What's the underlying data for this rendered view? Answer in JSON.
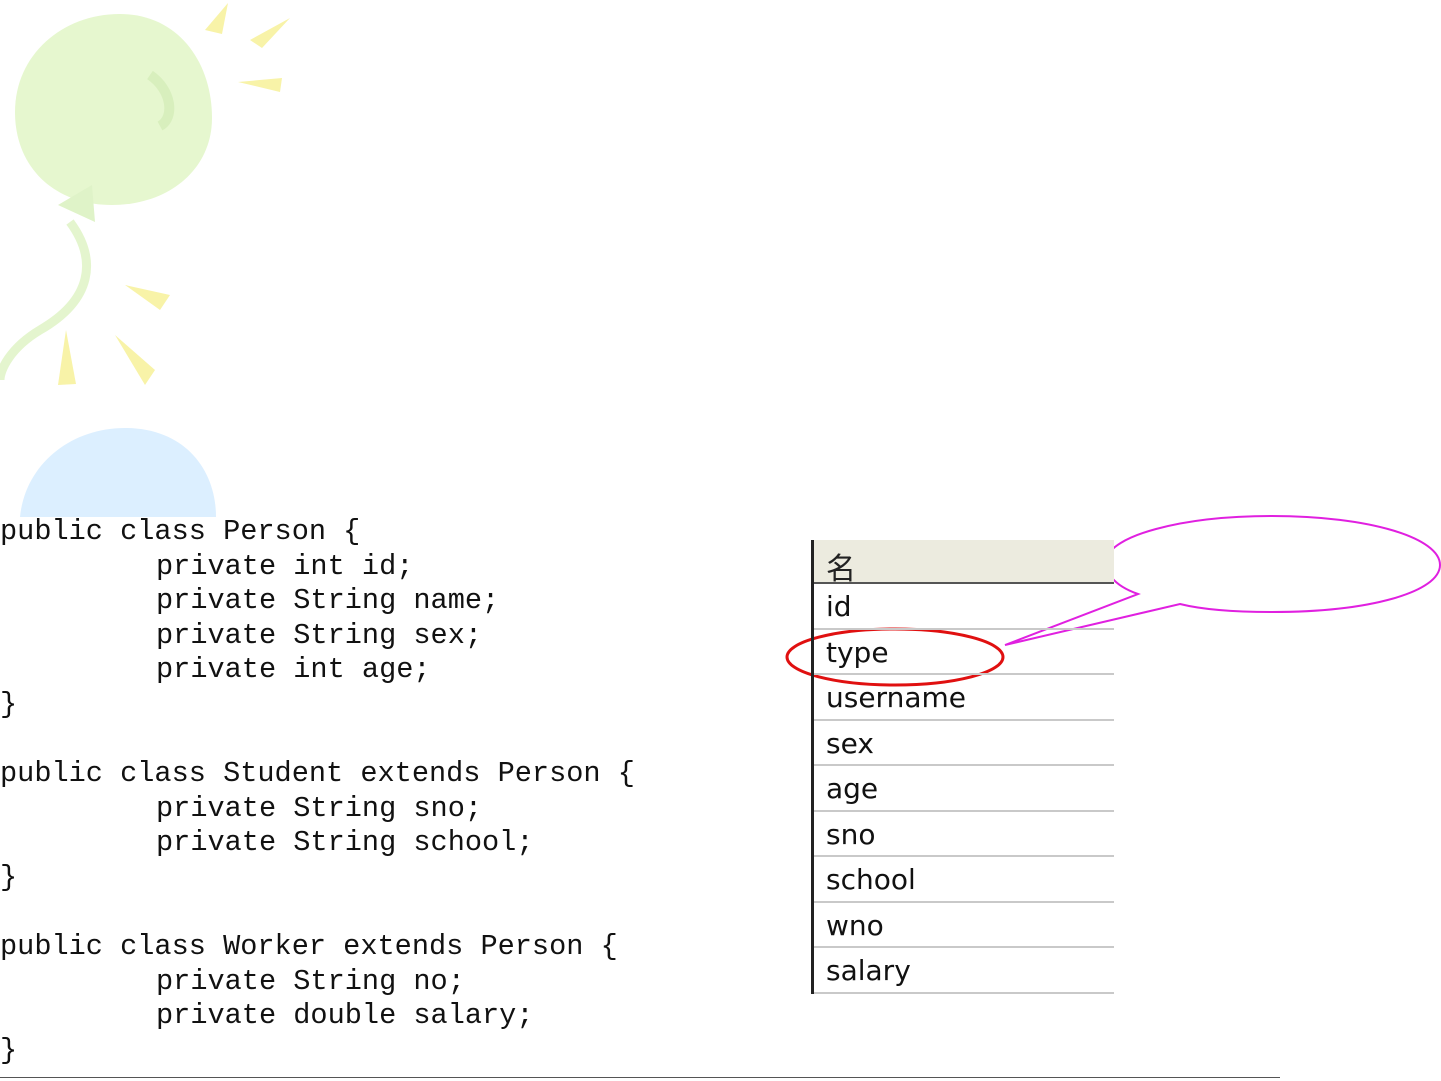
{
  "code_lines": [
    {
      "text": "public class Person {",
      "indent": false
    },
    {
      "text": "private int id;",
      "indent": true
    },
    {
      "text": "private String name;",
      "indent": true
    },
    {
      "text": "private String sex;",
      "indent": true
    },
    {
      "text": "private int age;",
      "indent": true
    },
    {
      "text": "}",
      "indent": false
    },
    {
      "text": "",
      "indent": false
    },
    {
      "text": "public class Student extends Person {",
      "indent": false
    },
    {
      "text": "private String sno;",
      "indent": true
    },
    {
      "text": "private String school;",
      "indent": true
    },
    {
      "text": "}",
      "indent": false
    },
    {
      "text": "",
      "indent": false
    },
    {
      "text": "public class Worker extends Person {",
      "indent": false
    },
    {
      "text": "private String no;",
      "indent": true
    },
    {
      "text": "private double salary;",
      "indent": true
    },
    {
      "text": "}",
      "indent": false
    }
  ],
  "field_table": {
    "header": "名",
    "rows": [
      "id",
      "type",
      "username",
      "sex",
      "age",
      "sno",
      "school",
      "wno",
      "salary"
    ],
    "highlighted_row": "type"
  },
  "colors": {
    "highlight_ellipse": "#e01010",
    "callout_stroke": "#e020e0",
    "decor_green": "#e6f7cf",
    "decor_yellow": "#f7f2a6",
    "decor_blue": "#dcefff"
  }
}
